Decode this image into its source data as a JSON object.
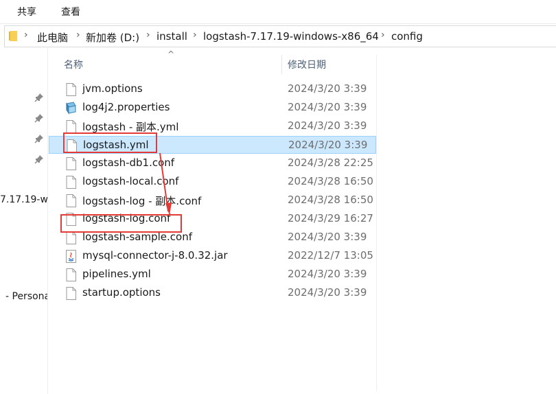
{
  "ribbon": {
    "tabs": [
      "共享",
      "查看"
    ]
  },
  "address": {
    "crumbs": [
      "此电脑",
      "新加卷 (D:)",
      "install",
      "logstash-7.17.19-windows-x86_64",
      "config"
    ]
  },
  "nav": {
    "items": [
      "7.17.19-w",
      "- Persona"
    ]
  },
  "columns": {
    "name": "名称",
    "modified": "修改日期"
  },
  "files": [
    {
      "name": "jvm.options",
      "date": "2024/3/20 3:39",
      "icon": "blank-file-icon"
    },
    {
      "name": "log4j2.properties",
      "date": "2024/3/20 3:39",
      "icon": "properties-file-icon"
    },
    {
      "name": "logstash - 副本.yml",
      "date": "2024/3/20 3:39",
      "icon": "blank-file-icon"
    },
    {
      "name": "logstash.yml",
      "date": "2024/3/20 3:39",
      "icon": "blank-file-icon",
      "selected": true
    },
    {
      "name": "logstash-db1.conf",
      "date": "2024/3/28 22:25",
      "icon": "blank-file-icon"
    },
    {
      "name": "logstash-local.conf",
      "date": "2024/3/28 16:50",
      "icon": "blank-file-icon"
    },
    {
      "name": "logstash-log - 副本.conf",
      "date": "2024/3/28 16:50",
      "icon": "blank-file-icon"
    },
    {
      "name": "logstash-log.conf",
      "date": "2024/3/29 16:27",
      "icon": "blank-file-icon"
    },
    {
      "name": "logstash-sample.conf",
      "date": "2024/3/20 3:39",
      "icon": "blank-file-icon"
    },
    {
      "name": "mysql-connector-j-8.0.32.jar",
      "date": "2022/12/7 13:05",
      "icon": "java-jar-icon"
    },
    {
      "name": "pipelines.yml",
      "date": "2024/3/20 3:39",
      "icon": "blank-file-icon"
    },
    {
      "name": "startup.options",
      "date": "2024/3/20 3:39",
      "icon": "blank-file-icon"
    }
  ],
  "colors": {
    "selection": "#cce8ff",
    "annotation": "#e53935",
    "header_text": "#4c607a"
  }
}
